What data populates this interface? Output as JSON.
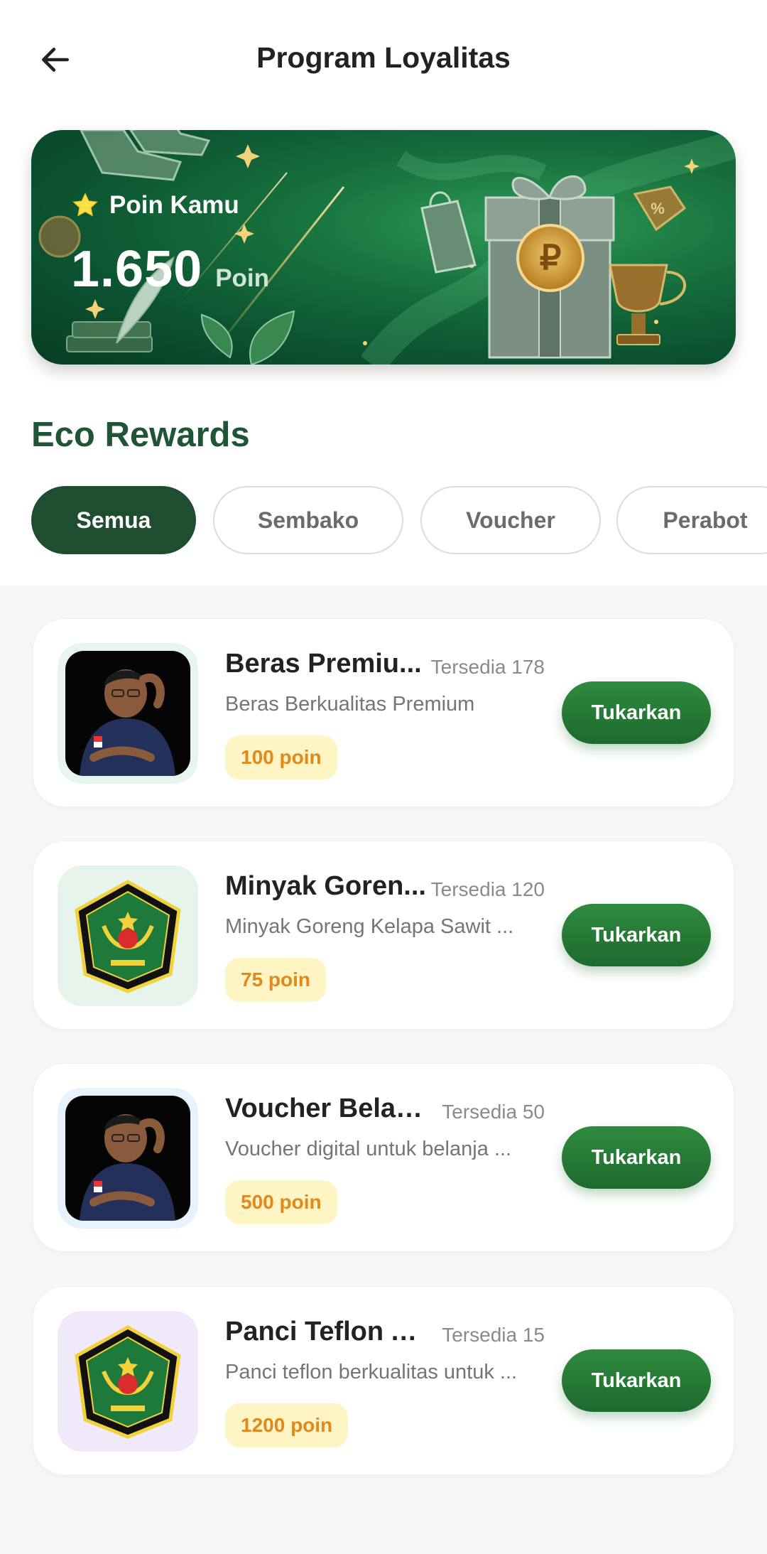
{
  "header": {
    "title": "Program Loyalitas"
  },
  "points_card": {
    "label": "Poin Kamu",
    "value": "1.650",
    "unit": "Poin"
  },
  "rewards": {
    "section_title": "Eco Rewards",
    "filters": [
      "Semua",
      "Sembako",
      "Voucher",
      "Perabot"
    ],
    "active_filter": "Semua",
    "redeem_label": "Tukarkan",
    "items": [
      {
        "title": "Beras Premiu...",
        "stock": "Tersedia 178",
        "description": "Beras Berkualitas Premium",
        "points": "100 poin",
        "image": "photo",
        "thumb_bg": "#e8f5ee"
      },
      {
        "title": "Minyak Goren...",
        "stock": "Tersedia 120",
        "description": "Minyak Goreng Kelapa Sawit ...",
        "points": "75 poin",
        "image": "logo",
        "thumb_bg": "#e6f4ec"
      },
      {
        "title": "Voucher Belanj...",
        "stock": "Tersedia 50",
        "description": "Voucher digital untuk belanja ...",
        "points": "500 poin",
        "image": "photo",
        "thumb_bg": "#e8f2fd"
      },
      {
        "title": "Panci Teflon A...",
        "stock": "Tersedia 15",
        "description": "Panci teflon berkualitas untuk ...",
        "points": "1200 poin",
        "image": "logo",
        "thumb_bg": "#efe9fa"
      }
    ]
  },
  "colors": {
    "accent": "#1e4d2f",
    "section_title": "#1f5434",
    "button": "#2a7a38",
    "points_badge_bg": "#fff4c4",
    "points_badge_text": "#e08a1e"
  },
  "icons": {
    "back": "arrow-left-icon",
    "star": "star-icon"
  }
}
